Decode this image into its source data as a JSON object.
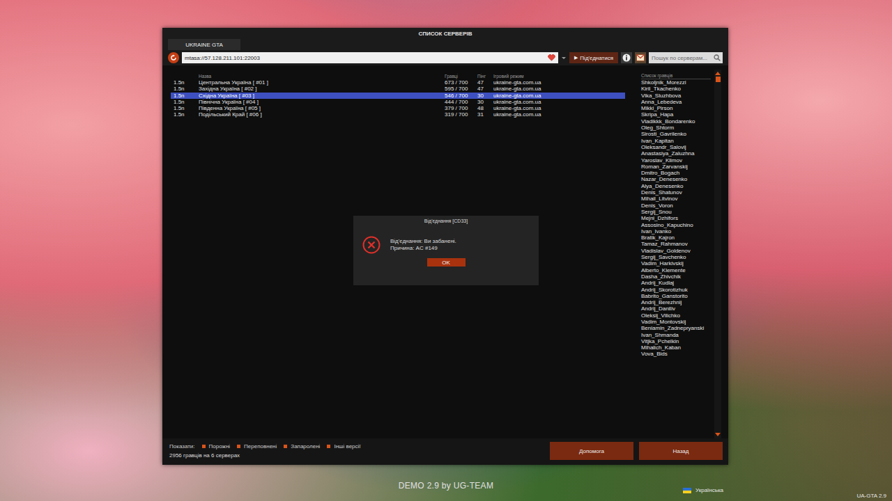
{
  "window": {
    "title": "СПИСОК СЕРВЕРІВ"
  },
  "tabs": [
    {
      "label": "UKRAINE GTA",
      "selected": true
    }
  ],
  "toolbar": {
    "address": "mtasa://57.128.211.101:22003",
    "favorite": true,
    "connect_icon": "▶",
    "connect_button": "Під'єднатися",
    "search_placeholder": "Пошук по серверам..."
  },
  "table": {
    "columns": [
      "Назва",
      "Гравці",
      "Пінг",
      "Ігровий режим"
    ],
    "rows": [
      {
        "version": "1.5n",
        "name": "Центральна Україна [ #01 ]",
        "players": "673 / 700",
        "ping": "47",
        "mode": "ukraine-gta.com.ua",
        "selected": false
      },
      {
        "version": "1.5n",
        "name": "Західна Україна [ #02 ]",
        "players": "595 / 700",
        "ping": "47",
        "mode": "ukraine-gta.com.ua",
        "selected": false
      },
      {
        "version": "1.5n",
        "name": "Східна Україна [ #03 ]",
        "players": "546 / 700",
        "ping": "30",
        "mode": "ukraine-gta.com.ua",
        "selected": true
      },
      {
        "version": "1.5n",
        "name": "Північна Україна [ #04 ]",
        "players": "444 / 700",
        "ping": "30",
        "mode": "ukraine-gta.com.ua",
        "selected": false
      },
      {
        "version": "1.5n",
        "name": "Південна Україна [ #05 ]",
        "players": "379 / 700",
        "ping": "48",
        "mode": "ukraine-gta.com.ua",
        "selected": false
      },
      {
        "version": "1.5n",
        "name": "Подільський Край [ #06 ]",
        "players": "319 / 700",
        "ping": "31",
        "mode": "ukraine-gta.com.ua",
        "selected": false
      }
    ]
  },
  "players": {
    "title": "Список гравців",
    "names": [
      "Shkoljnik_Morezzi",
      "Kiril_Tkachenko",
      "Vika_Sluzhbova",
      "Anna_Lebedeva",
      "Mikki_Pirson",
      "Skripa_Hapa",
      "Vladikkk_Bondarenko",
      "Oleg_Shtorm",
      "Sirosti_Gavrilenko",
      "Ivan_Kapitan",
      "Oleksandr_Salovij",
      "Anastasiya_Zaluzhna",
      "Yaroslav_Klimov",
      "Roman_Zarvanskij",
      "Dmitro_Bogach",
      "Nazar_Denesenko",
      "Alya_Denesenko",
      "Denis_Shatunov",
      "Mihail_Litvinov",
      "Denis_Voron",
      "Sergij_Snou",
      "Mejni_Dzhifors",
      "Assosino_Kapuchino",
      "Ivan_Ivanko",
      "Bratik_Kajron",
      "Tamaz_Rahmanov",
      "Vladislav_Goldenov",
      "Sergij_Savchenko",
      "Vadim_Harkivskij",
      "Alberto_Klemente",
      "Dasha_Zhivchik",
      "Andrij_Kudlaj",
      "Andrij_Skorotizhuk",
      "Babrito_Ganstorito",
      "Andrij_Berezhnij",
      "Andrij_Daniliv",
      "Oleksij_Vilichko",
      "Vadim_Montovskij",
      "Beniamin_Zadnepryanski",
      "Ivan_Shmanda",
      "Vitjka_Pchelkin",
      "Mihalich_Kaban",
      "Vova_Bids"
    ]
  },
  "filters": {
    "label": "Показати:",
    "items": [
      {
        "label": "Порожні",
        "checked": true
      },
      {
        "label": "Переповнені",
        "checked": true
      },
      {
        "label": "Запаролені",
        "checked": true
      },
      {
        "label": "Інші версії",
        "checked": true
      }
    ]
  },
  "status": "2956 гравців на 6 серверах",
  "buttons": [
    "Допомога",
    "Назад"
  ],
  "dialog": {
    "title": "Від'єднання [CD33]",
    "lines": [
      "Від'єднання: Ви забанені.",
      "Причина: AC #149"
    ],
    "button": "OK"
  },
  "footer": {
    "version_label": "DEMO 2.9 by UG-TEAM",
    "language": "Українська",
    "build": "UA-GTA 2.9"
  }
}
